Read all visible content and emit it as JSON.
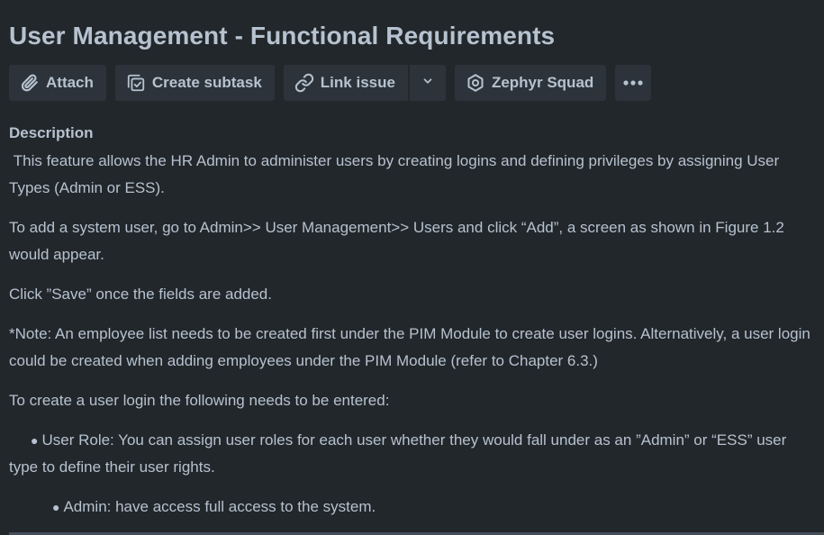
{
  "issue": {
    "title": "User Management - Functional Requirements"
  },
  "toolbar": {
    "attach_label": "Attach",
    "create_subtask_label": "Create subtask",
    "link_issue_label": "Link issue",
    "zephyr_label": "Zephyr Squad",
    "icons": {
      "attach": "paperclip-icon",
      "subtask": "subtask-icon",
      "link": "link-icon",
      "dropdown": "chevron-down-icon",
      "zephyr": "hexagon-icon",
      "more": "more-icon"
    }
  },
  "description": {
    "heading": "Description",
    "paragraphs": [
      " This feature allows the HR Admin to administer users by creating logins and defining privileges by assigning User Types (Admin or ESS).",
      "To add a system user, go to Admin>> User Management>> Users and click “Add”, a screen as shown in Figure 1.2 would appear.",
      "Click ”Save” once the fields are added.",
      "*Note: An employee list needs to be created first under the PIM Module to create user logins. Alternatively, a user login could be created when adding employees under the PIM Module (refer to Chapter 6.3.)",
      "To create a user login the following needs to be entered:"
    ],
    "bullets": [
      "User Role: You can assign user roles for each user whether they would fall under as an ”Admin” or “ESS” user type to define their user rights.",
      "Admin: have access full access to the system."
    ]
  },
  "colors": {
    "background": "#22272b",
    "button": "#2c333a",
    "text": "#b6c2cf"
  }
}
